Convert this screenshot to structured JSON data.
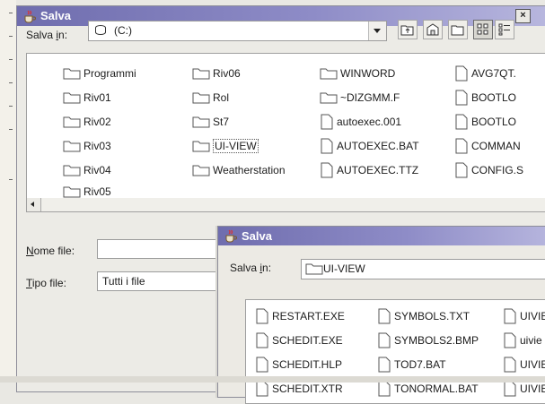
{
  "back_dialog": {
    "title": "Salva",
    "close_label": "×",
    "save_in_label_prefix": "Salva ",
    "save_in_label_underlined": "i",
    "save_in_label_suffix": "n:",
    "location_value": "(C:)",
    "drive_icon": "hard-drive-icon",
    "toolbar_icons": [
      "up-folder-icon",
      "home-icon",
      "new-folder-icon",
      "list-view-icon",
      "details-view-icon"
    ],
    "files": [
      {
        "name": "Programmi",
        "kind": "folder"
      },
      {
        "name": "Riv01",
        "kind": "folder"
      },
      {
        "name": "Riv02",
        "kind": "folder"
      },
      {
        "name": "Riv03",
        "kind": "folder"
      },
      {
        "name": "Riv04",
        "kind": "folder"
      },
      {
        "name": "Riv05",
        "kind": "folder"
      },
      {
        "name": "Riv06",
        "kind": "folder"
      },
      {
        "name": "Rol",
        "kind": "folder"
      },
      {
        "name": "St7",
        "kind": "folder"
      },
      {
        "name": "UI-VIEW",
        "kind": "folder",
        "selected": true
      },
      {
        "name": "Weatherstation",
        "kind": "folder"
      },
      {
        "name": "WINWORD",
        "kind": "folder"
      },
      {
        "name": "~DIZGMM.F",
        "kind": "folder"
      },
      {
        "name": "autoexec.001",
        "kind": "file"
      },
      {
        "name": "AUTOEXEC.BAT",
        "kind": "file"
      },
      {
        "name": "AUTOEXEC.TTZ",
        "kind": "file"
      },
      {
        "name": "AVG7QT.",
        "kind": "file"
      },
      {
        "name": "BOOTLO",
        "kind": "file"
      },
      {
        "name": "BOOTLO",
        "kind": "file"
      },
      {
        "name": "COMMAN",
        "kind": "file"
      },
      {
        "name": "CONFIG.S",
        "kind": "file"
      }
    ],
    "file_name_label_underlined": "N",
    "file_name_label_rest": "ome file:",
    "file_name_value": "",
    "file_type_label_underlined": "T",
    "file_type_label_rest": "ipo file:",
    "file_type_value": "Tutti i file"
  },
  "front_dialog": {
    "title": "Salva",
    "save_in_label_prefix": "Salva ",
    "save_in_label_underlined": "i",
    "save_in_label_suffix": "n:",
    "location_value": "UI-VIEW",
    "files": [
      {
        "name": "RESTART.EXE"
      },
      {
        "name": "SCHEDIT.EXE"
      },
      {
        "name": "SCHEDIT.HLP"
      },
      {
        "name": "SCHEDIT.XTR"
      },
      {
        "name": "SYMBOLS.TXT"
      },
      {
        "name": "SYMBOLS2.BMP"
      },
      {
        "name": "TOD7.BAT"
      },
      {
        "name": "TONORMAL.BAT"
      },
      {
        "name": "UIVIE"
      },
      {
        "name": "uivie"
      },
      {
        "name": "UIVIE"
      },
      {
        "name": "UIVIE"
      }
    ]
  },
  "colors": {
    "titlebar": "#7e7cbd",
    "window_bg": "#ecebe6",
    "list_bg": "#ffffff"
  }
}
